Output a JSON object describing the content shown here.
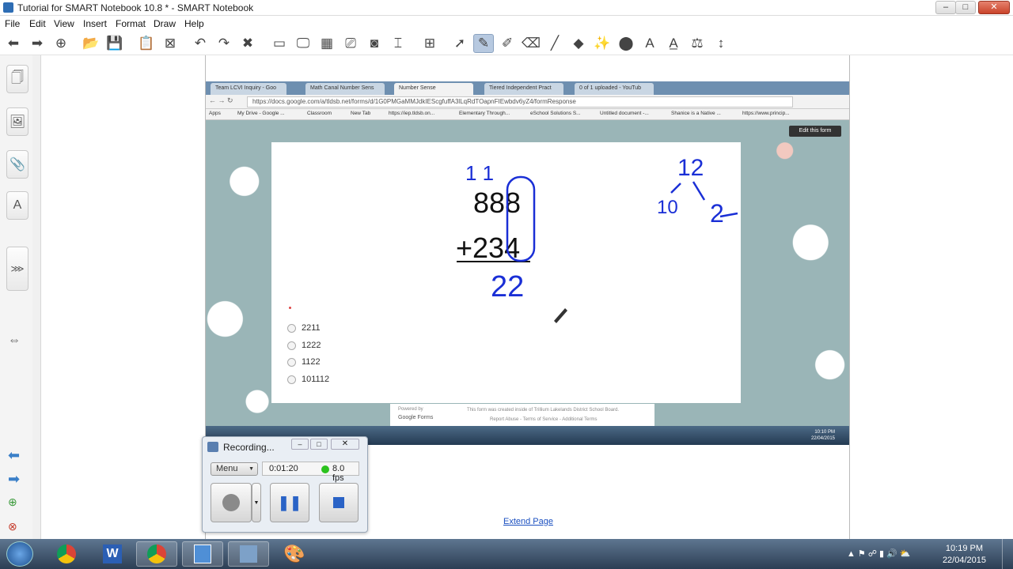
{
  "window": {
    "title": "Tutorial for SMART Notebook 10.8 * - SMART Notebook",
    "min": "–",
    "max": "□",
    "close": "✕"
  },
  "menu": [
    "File",
    "Edit",
    "View",
    "Insert",
    "Format",
    "Draw",
    "Help"
  ],
  "toolbar": [
    {
      "icon": "back-icon",
      "glyph": "⬅"
    },
    {
      "icon": "forward-icon",
      "glyph": "➡"
    },
    {
      "icon": "add-page-icon",
      "glyph": "⊕"
    },
    {
      "icon": "open-file-icon",
      "glyph": "📂"
    },
    {
      "icon": "save-icon",
      "glyph": "💾"
    },
    {
      "icon": "paste-icon",
      "glyph": "📋"
    },
    {
      "icon": "full-screen-icon",
      "glyph": "⊠"
    },
    {
      "icon": "undo-icon",
      "glyph": "↶"
    },
    {
      "icon": "redo-icon",
      "glyph": "↷"
    },
    {
      "icon": "delete-icon",
      "glyph": "✖"
    },
    {
      "icon": "screen-shade-icon",
      "glyph": "▭"
    },
    {
      "icon": "display-icon",
      "glyph": "🖵"
    },
    {
      "icon": "capture-icon",
      "glyph": "▦"
    },
    {
      "icon": "document-camera-icon",
      "glyph": "⎚"
    },
    {
      "icon": "camera-icon",
      "glyph": "◙"
    },
    {
      "icon": "screen-capture-icon",
      "glyph": "⌶"
    },
    {
      "icon": "table-icon",
      "glyph": "⊞"
    },
    {
      "icon": "select-icon",
      "glyph": "➚"
    },
    {
      "icon": "pen-icon",
      "glyph": "✎",
      "active": true
    },
    {
      "icon": "creative-pen-icon",
      "glyph": "✐"
    },
    {
      "icon": "eraser-icon",
      "glyph": "⌫"
    },
    {
      "icon": "line-icon",
      "glyph": "╱"
    },
    {
      "icon": "shapes-icon",
      "glyph": "◆"
    },
    {
      "icon": "magic-pen-icon",
      "glyph": "✨"
    },
    {
      "icon": "fill-icon",
      "glyph": "⬤"
    },
    {
      "icon": "text-icon",
      "glyph": "A"
    },
    {
      "icon": "properties-icon",
      "glyph": "A̲"
    },
    {
      "icon": "measurement-icon",
      "glyph": "⚖"
    },
    {
      "icon": "move-toolbar-icon",
      "glyph": "↕"
    }
  ],
  "sidetabs": [
    {
      "icon": "page-sorter-icon",
      "glyph": "🗍"
    },
    {
      "icon": "gallery-icon",
      "glyph": "🖼"
    },
    {
      "icon": "attachments-icon",
      "glyph": "📎"
    },
    {
      "icon": "properties-tab-icon",
      "glyph": "A"
    }
  ],
  "browser": {
    "tabs": [
      "Team LCVI Inquiry - Goo",
      "Math Canal Number Sens",
      "Number Sense",
      "Tiered Independent Pract",
      "0 of 1 uploaded - YouTub"
    ],
    "url": "https://docs.google.com/a/tldsb.net/forms/d/1G0PMGaMMJdkIEScgfuffA3lLqRdTOapnFIEwbdv6yZ4/formResponse",
    "bookmarks": [
      "Apps",
      "My Drive - Google ...",
      "Classroom",
      "New Tab",
      "https://iep.tldsb.on...",
      "Elementary Through...",
      "eSchool Solutions S...",
      "Untitled document -...",
      "Shanice is a Native ...",
      "https://www.princip..."
    ],
    "edit_form": "Edit this form",
    "problem": {
      "carry": "1  1",
      "top": "888",
      "bottom": "+234",
      "partial": "22",
      "decomp_top": "12",
      "decomp_left": "10",
      "decomp_right": "2"
    },
    "options": [
      "2211",
      "1222",
      "1122",
      "101112"
    ],
    "footer": {
      "powered": "Powered by",
      "brand": "Google Forms",
      "note": "This form was created inside of Trillium Lakelands District School Board.",
      "links": "Report Abuse - Terms of Service - Additional Terms"
    },
    "clock": {
      "time": "10:10 PM",
      "date": "22/04/2015"
    }
  },
  "recorder": {
    "title": "Recording...",
    "menu": "Menu",
    "elapsed": "0:01:20",
    "fps": "8.0 fps"
  },
  "extend_page": "Extend Page",
  "taskbar": {
    "time": "10:19 PM",
    "date": "22/04/2015"
  }
}
